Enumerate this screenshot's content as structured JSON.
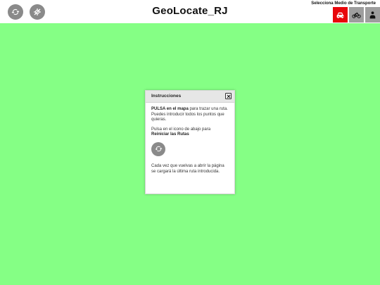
{
  "header": {
    "title": "GeoLocate_RJ",
    "reset_icon": "refresh-icon",
    "locate_icon": "crosshair-slash-icon"
  },
  "transport": {
    "label": "Selecciona Medio de Transporte",
    "options": [
      {
        "name": "car",
        "icon": "car-icon",
        "color": "#e8060b",
        "selected": true
      },
      {
        "name": "bike",
        "icon": "bicycle-icon",
        "color": "#9e9e9e",
        "selected": false
      },
      {
        "name": "walk",
        "icon": "person-icon",
        "color": "#9e9e9e",
        "selected": false
      }
    ]
  },
  "map": {
    "background": "#85ff85"
  },
  "dialog": {
    "title": "Instrucciones",
    "p1_bold": "PULSA en el mapa",
    "p1_text": " para trazar una ruta. Puedes introducir todos los puntos que quieras.",
    "p2_text": "Pulsa en el icono de abajo para ",
    "p2_bold": "Reiniciar las Rutas",
    "p3_text": "Cada vez que vuelvas a abrir la página se cargará la última ruta introducida."
  }
}
